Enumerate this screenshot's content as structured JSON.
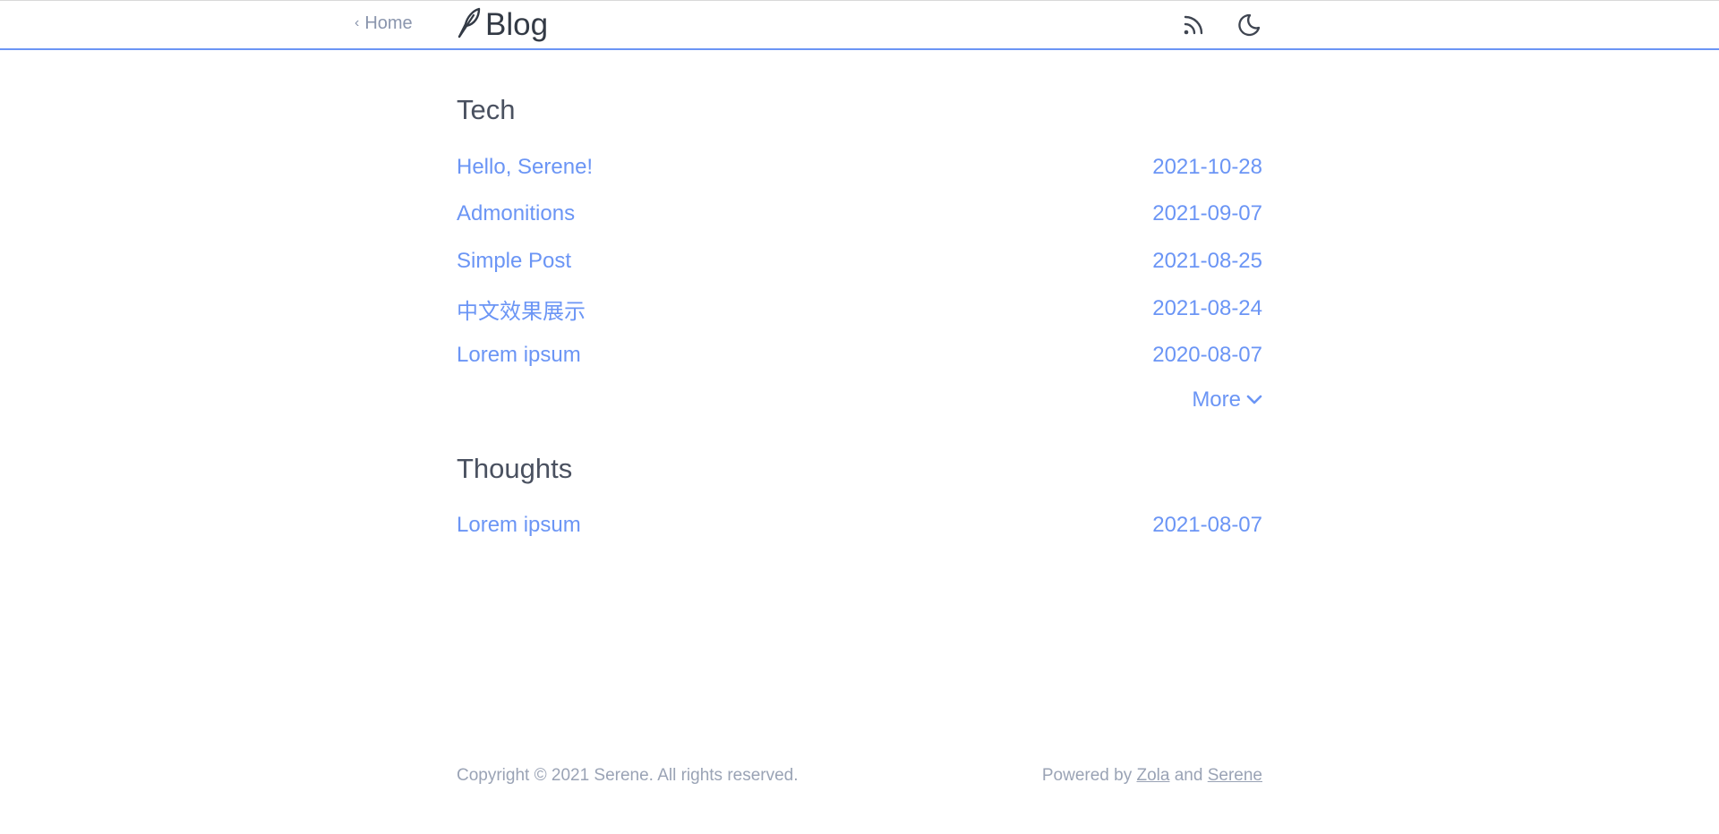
{
  "header": {
    "home_label": "Home",
    "brand_title": "Blog",
    "icons": [
      "chevron-left-icon",
      "feather-icon",
      "rss-icon",
      "moon-icon"
    ]
  },
  "sections": [
    {
      "title": "Tech",
      "posts": [
        {
          "title": "Hello, Serene!",
          "date": "2021-10-28"
        },
        {
          "title": "Admonitions",
          "date": "2021-09-07"
        },
        {
          "title": "Simple Post",
          "date": "2021-08-25"
        },
        {
          "title": "中文效果展示",
          "date": "2021-08-24"
        },
        {
          "title": "Lorem ipsum",
          "date": "2020-08-07"
        }
      ],
      "more_label": "More"
    },
    {
      "title": "Thoughts",
      "posts": [
        {
          "title": "Lorem ipsum",
          "date": "2021-08-07"
        }
      ]
    }
  ],
  "footer": {
    "copyright": "Copyright © 2021 Serene. All rights reserved.",
    "powered_prefix": "Powered by",
    "zola_link": "Zola",
    "and_text": "and",
    "serene_link": "Serene"
  },
  "colors": {
    "accent": "#6b95f5",
    "heading": "#4a5160",
    "muted": "#9aa3b5"
  }
}
